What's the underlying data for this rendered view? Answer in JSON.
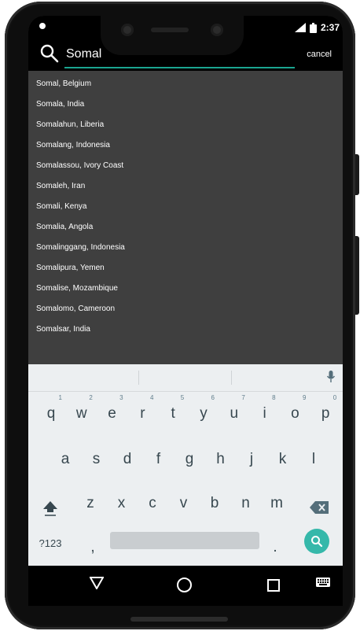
{
  "status": {
    "time": "2:37",
    "battery_icon": "battery-icon",
    "signal_icon": "signal-icon"
  },
  "search": {
    "query": "Somal",
    "cancel_label": "cancel"
  },
  "results": [
    "Somal, Belgium",
    "Somala, India",
    "Somalahun, Liberia",
    "Somalang, Indonesia",
    "Somalassou, Ivory Coast",
    "Somaleh, Iran",
    "Somali, Kenya",
    "Somalia, Angola",
    "Somalinggang, Indonesia",
    "Somalipura, Yemen",
    "Somalise, Mozambique",
    "Somalomo, Cameroon",
    "Somalsar, India"
  ],
  "keyboard": {
    "row1": [
      {
        "ch": "q",
        "num": "1"
      },
      {
        "ch": "w",
        "num": "2"
      },
      {
        "ch": "e",
        "num": "3"
      },
      {
        "ch": "r",
        "num": "4"
      },
      {
        "ch": "t",
        "num": "5"
      },
      {
        "ch": "y",
        "num": "6"
      },
      {
        "ch": "u",
        "num": "7"
      },
      {
        "ch": "i",
        "num": "8"
      },
      {
        "ch": "o",
        "num": "9"
      },
      {
        "ch": "p",
        "num": "0"
      }
    ],
    "row2": [
      "a",
      "s",
      "d",
      "f",
      "g",
      "h",
      "j",
      "k",
      "l"
    ],
    "row3": [
      "z",
      "x",
      "c",
      "v",
      "b",
      "n",
      "m"
    ],
    "symbols_label": "?123",
    "comma_label": ",",
    "period_label": "."
  },
  "colors": {
    "accent": "#1aa590",
    "go_button": "#35b8aa",
    "list_bg": "#3f3f3f"
  }
}
